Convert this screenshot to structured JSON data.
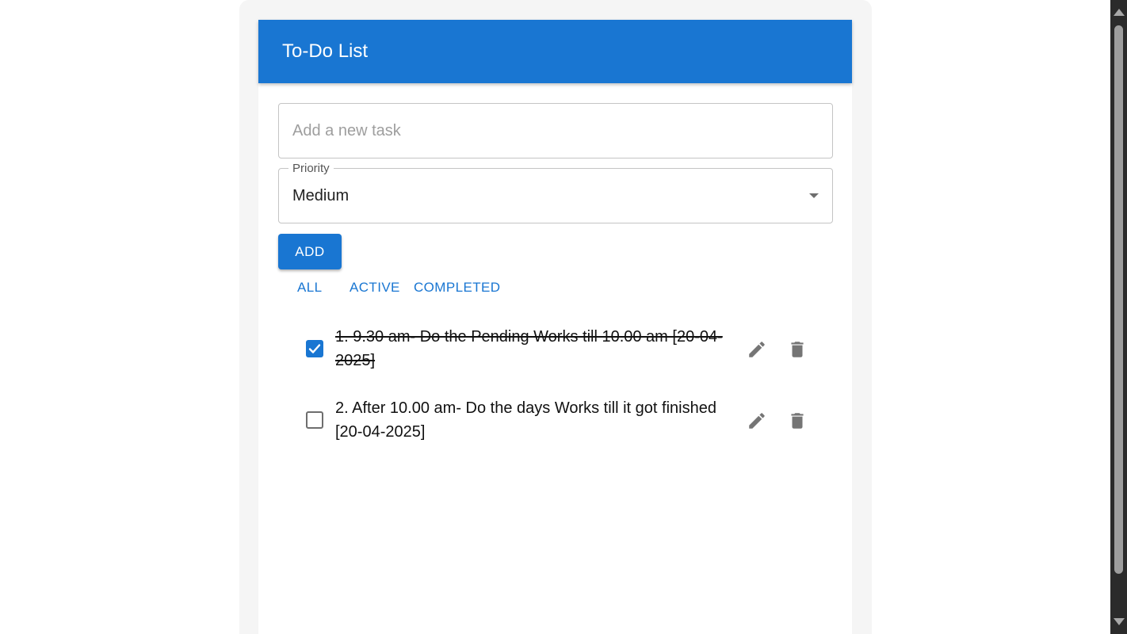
{
  "app": {
    "title": "To-Do List"
  },
  "new_task": {
    "placeholder": "Add a new task",
    "value": ""
  },
  "priority": {
    "label": "Priority",
    "selected": "Medium",
    "icon": "arrow-drop-down-icon"
  },
  "add_button": {
    "label": "ADD"
  },
  "filters": [
    "ALL",
    "ACTIVE",
    "COMPLETED"
  ],
  "todos": [
    {
      "text": "1. 9.30 am- Do the Pending Works till 10.00 am [20-04-2025]",
      "completed": true
    },
    {
      "text": "2. After 10.00 am- Do the days Works till it got finished [20-04-2025]",
      "completed": false
    }
  ],
  "colors": {
    "primary": "#1976d2",
    "icon_gray": "#757575",
    "scrollbar_track": "#2b2b2b",
    "scrollbar_thumb": "#9e9e9e"
  }
}
